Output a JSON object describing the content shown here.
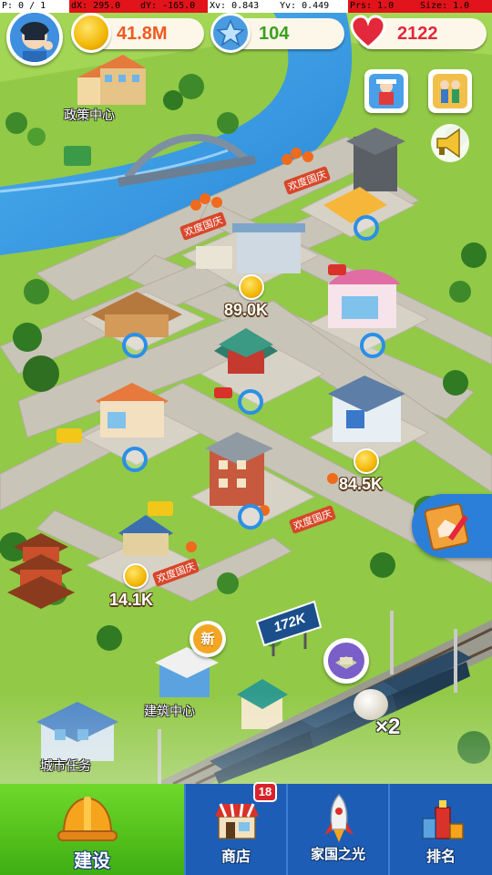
{
  "debug": {
    "pointer": "P: 0 / 1",
    "dx": "dX: 295.0",
    "dy": "dY: -165.0",
    "xv": "Xv: 0.843",
    "yv": "Yv: 0.449",
    "prs": "Prs: 1.0",
    "size": "Size: 1.0"
  },
  "resources": {
    "gold": "41.8M",
    "stars": "104",
    "hearts": "2122"
  },
  "colors": {
    "gold_text": "#f05a1f",
    "star_text": "#3aa01e",
    "heart_text": "#e2283a",
    "nav_blue": "#1e5db5",
    "nav_green": "#55c21a",
    "badge_red": "#d8232a"
  },
  "icons": {
    "avatar": "player-avatar-icon",
    "gold": "gold-coin-icon",
    "star": "star-icon",
    "heart": "heart-icon",
    "event1": "event-icon",
    "event2": "event-icon",
    "megaphone": "megaphone-icon",
    "task_book": "task-book-icon"
  },
  "map": {
    "labels": {
      "policy_center": "政策中心",
      "building_center": "建筑中心",
      "city_tasks": "城市任务"
    },
    "incomes": [
      "89.0K",
      "84.5K",
      "14.1K"
    ],
    "billboard": "172K",
    "new_badge": "新",
    "train_multiplier": "×2",
    "banner_text": "欢度国庆"
  },
  "nav": {
    "build": "建设",
    "shop": "商店",
    "shop_badge": "18",
    "home_light": "家国之光",
    "ranking": "排名"
  }
}
